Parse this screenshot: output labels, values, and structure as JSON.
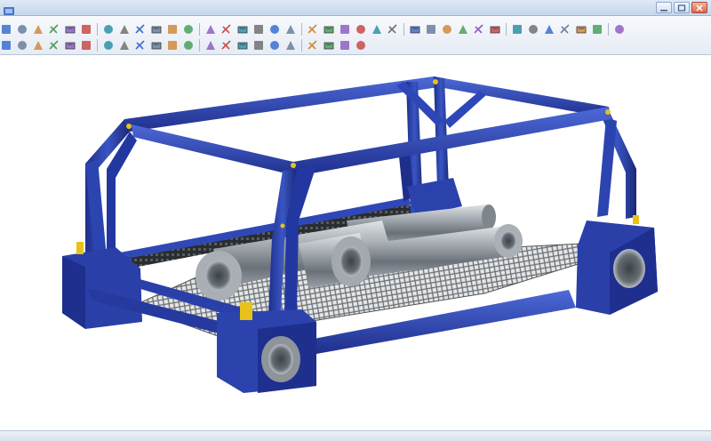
{
  "titlebar": {
    "app_label": "",
    "title": ""
  },
  "ribbon": {
    "row1_icons": [
      "new-icon",
      "open-icon",
      "save-icon",
      "undo-icon",
      "redo-icon",
      "print-icon",
      "cut-icon",
      "copy-icon",
      "paste-icon",
      "select-icon",
      "rotate-icon",
      "zoom-icon",
      "pan-icon",
      "fit-icon",
      "view-front-icon",
      "view-top-icon",
      "view-iso-icon",
      "section-icon",
      "measure-icon",
      "render-icon",
      "mesh-icon",
      "material-icon",
      "light-icon",
      "grid-icon",
      "layer-icon",
      "sketch-icon",
      "extrude-icon",
      "revolve-icon",
      "sweep-icon",
      "loft-icon",
      "fillet-icon",
      "chamfer-icon",
      "shell-icon",
      "pattern-icon",
      "mirror-icon",
      "assembly-icon",
      "part-icon"
    ],
    "row2_icons": [
      "line-icon",
      "arc-icon",
      "circle-icon",
      "rectangle-icon",
      "polygon-icon",
      "spline-icon",
      "trim-icon",
      "extend-icon",
      "offset-icon",
      "dimension-icon",
      "constraint-icon",
      "weld-icon",
      "bolt-icon",
      "pipe-icon",
      "beam-icon",
      "plate-icon",
      "frame-icon",
      "tube-icon",
      "bend-icon",
      "cutlist-icon",
      "drawing-icon",
      "export-icon"
    ]
  },
  "viewport": {
    "model": "frame-assembly",
    "colors": {
      "frame": "#2c44b0",
      "frame_dark": "#17267a",
      "frame_light": "#4d6ad8",
      "pipe": "#9aa1a8",
      "pipe_dark": "#4e555c",
      "mesh": "#7c8084",
      "accent": "#e8c21a"
    }
  },
  "statusbar": {
    "text": ""
  }
}
